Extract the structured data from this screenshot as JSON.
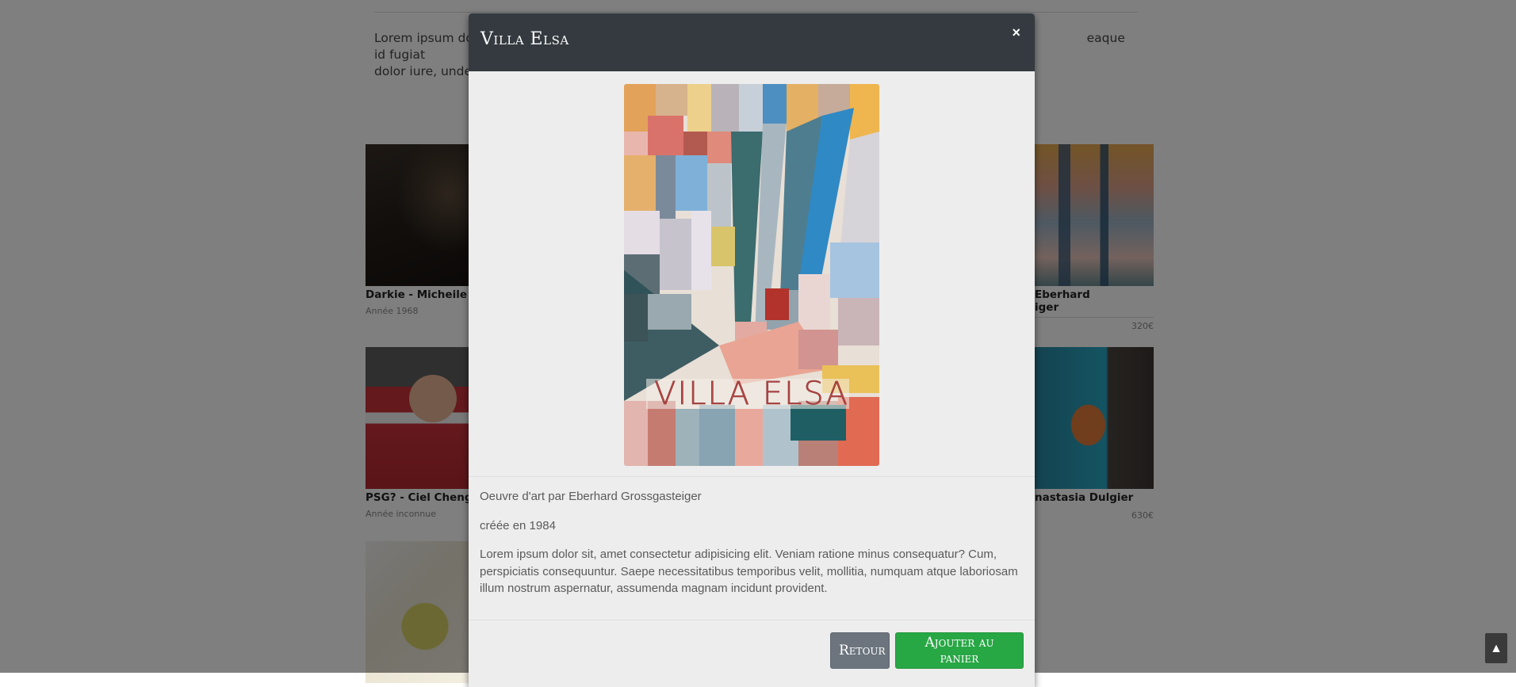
{
  "background": {
    "intro_left": "Lorem ipsum dolo",
    "intro_left_2": "dolor iure, unde o",
    "intro_right": "eaque id fugiat",
    "cards": [
      {
        "title": "Darkie - Micheile He",
        "meta": "Année 1968"
      },
      {
        "title": "PSG? - Ciel Cheng",
        "meta": "Année inconnue"
      },
      {
        "title": "",
        "meta": ""
      },
      {
        "title": "Eberhard",
        "title_line2": "iger",
        "meta": "320€"
      },
      {
        "title": "nastasia Dulgier",
        "meta": "630€"
      }
    ]
  },
  "modal": {
    "title": "Villa Elsa",
    "close_label": "×",
    "image_text": "VILLA ELSA",
    "artist_line": "Oeuvre d'art par Eberhard Grossgasteiger",
    "created_line": "créée en 1984",
    "description": "Lorem ipsum dolor sit, amet consectetur adipisicing elit. Veniam ratione minus consequatur? Cum, perspiciatis consequuntur. Saepe necessitatibus temporibus velit, mollitia, numquam atque laboriosam illum nostrum aspernatur, assumenda magnam incidunt provident.",
    "back_label": "Retour",
    "cart_label": "Ajouter au panier"
  },
  "scroll_top": {
    "label": "▲"
  },
  "colors": {
    "header_bg": "#343a40",
    "back_button": "#6c757d",
    "cart_button": "#28a745",
    "modal_bg": "#ededed"
  }
}
